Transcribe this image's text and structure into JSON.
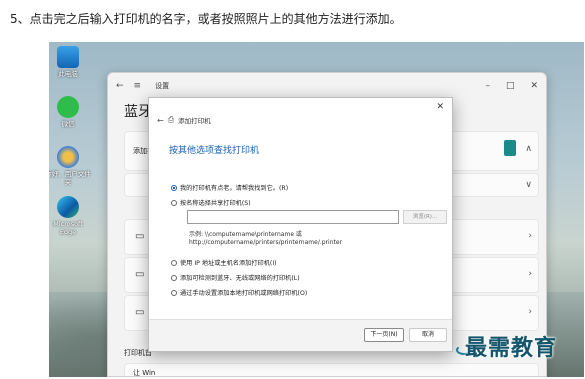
{
  "instruction": "5、点击完之后输入打印机的名字，或者按照照片上的其他方法进行添加。",
  "desktop": {
    "icons": [
      {
        "label": "此电脑",
        "icon": "computer-icon"
      },
      {
        "label": "微信",
        "icon": "wechat-icon"
      },
      {
        "label": "你好，用户文件夹",
        "icon": "user-folder-icon"
      },
      {
        "label": "Microsoft Edge",
        "icon": "edge-icon"
      }
    ]
  },
  "settings": {
    "title": "设置",
    "heading": "蓝牙",
    "add_label": "添加打印",
    "section_label": "打印机首",
    "bottom_label": "让 Win"
  },
  "dialog": {
    "title": "添加打印机",
    "heading": "按其他选项查找打印机",
    "options": [
      "我的打印机有点老。请帮我找到它。(R)",
      "按名称选择共享打印机(S)",
      "使用 IP 地址或主机名添加打印机(I)",
      "添加可检测到蓝牙、无线或网络的打印机(L)",
      "通过手动设置添加本地打印机或网络打印机(O)"
    ],
    "selected_index": 0,
    "input_value": "",
    "browse_label": "浏览(R)...",
    "example_line1": "示例: \\\\computername\\printername 或",
    "example_line2": "http://computername/printers/printername/.printer",
    "next_label": "下一页(N)",
    "cancel_label": "取消"
  },
  "watermark": "最需教育",
  "colors": {
    "accent": "#1a5fb4",
    "teal": "#1a8a8a",
    "watermark": "#13566b"
  }
}
